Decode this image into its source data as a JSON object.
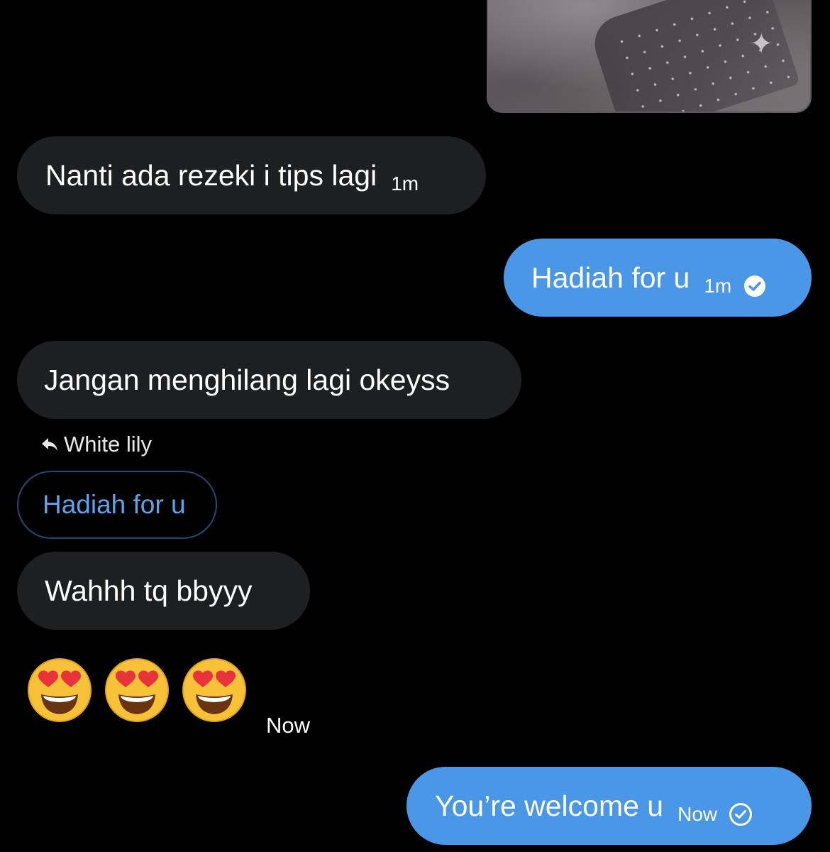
{
  "messages": [
    {
      "id": "m1",
      "type": "image",
      "direction": "outgoing"
    },
    {
      "id": "m2",
      "direction": "incoming",
      "text": "Nanti ada rezeki i tips lagi",
      "time": "1m"
    },
    {
      "id": "m3",
      "direction": "outgoing",
      "text": "Hadiah for u",
      "time": "1m",
      "status": "seen"
    },
    {
      "id": "m4",
      "direction": "incoming",
      "text": "Jangan menghilang lagi okeyss"
    },
    {
      "id": "m5",
      "direction": "incoming",
      "reply_to_name": "White lily",
      "reply_quote": "Hadiah for u"
    },
    {
      "id": "m6",
      "direction": "incoming",
      "text": "Wahhh tq bbyyy"
    },
    {
      "id": "m7",
      "direction": "incoming",
      "emoji": [
        "😍",
        "😍",
        "😍"
      ],
      "emoji_icon": "heart-eyes-emoji",
      "time": "Now"
    },
    {
      "id": "m8",
      "direction": "outgoing",
      "text": "You’re welcome u",
      "time": "Now",
      "status": "sent"
    }
  ],
  "colors": {
    "background": "#000000",
    "incoming_bubble": "#1d1f21",
    "outgoing_bubble": "#4a97e8",
    "reply_accent": "#5aa3ee"
  }
}
